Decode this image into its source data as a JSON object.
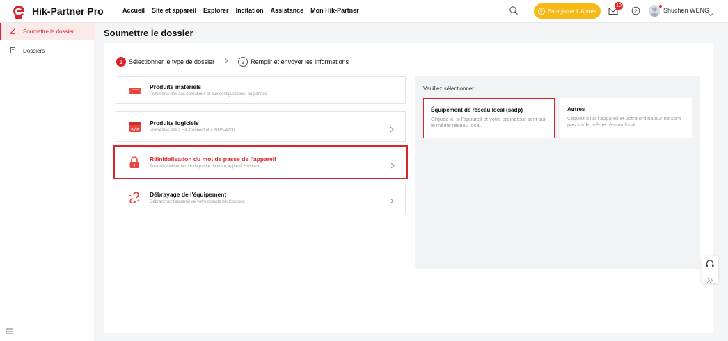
{
  "header": {
    "brand": "Hik-Partner Pro",
    "nav": [
      "Accueil",
      "Site et appareil",
      "Explorer",
      "Incitation",
      "Assistance",
      "Mon Hik-Partner"
    ],
    "register_label": "Enregistrer L'Année",
    "mail_count": "10",
    "username": "Shuchen WENG"
  },
  "sidebar": {
    "items": [
      {
        "label": "Soumettre le dossier",
        "active": true
      },
      {
        "label": "Dossiers",
        "active": false
      }
    ]
  },
  "page": {
    "title": "Soumettre le dossier"
  },
  "steps": [
    {
      "num": "1",
      "label": "Sélectionner le type de dossier"
    },
    {
      "num": "2",
      "label": "Remplir et envoyer les informations"
    }
  ],
  "options": [
    {
      "title": "Produits matériels",
      "desc": "Problèmes liés aux opérations et aux configurations, ou pannes."
    },
    {
      "title": "Produits logiciels",
      "desc": "Problèmes liés à Hik-Connect et à iVMS-4200."
    },
    {
      "title": "Réinitialisation du mot de passe de l'appareil",
      "desc": "Pour réinitialiser le mot de passe de votre appareil Hikvision."
    },
    {
      "title": "Débrayage de l'équipement",
      "desc": "Débranchez l'appareil de votre compte hik Connect."
    }
  ],
  "right_panel": {
    "label": "Veuillez sélectionner",
    "choices": [
      {
        "title": "Équipement de réseau local (sadp)",
        "desc": "Cliquez ici si l'appareil et votre ordinateur sont sur le même réseau local."
      },
      {
        "title": "Autres",
        "desc": "Cliquez ici si l'appareil et votre ordinateur ne sont pas sur le même réseau local."
      }
    ]
  },
  "colors": {
    "accent": "#d8242a",
    "register": "#f7b916"
  }
}
